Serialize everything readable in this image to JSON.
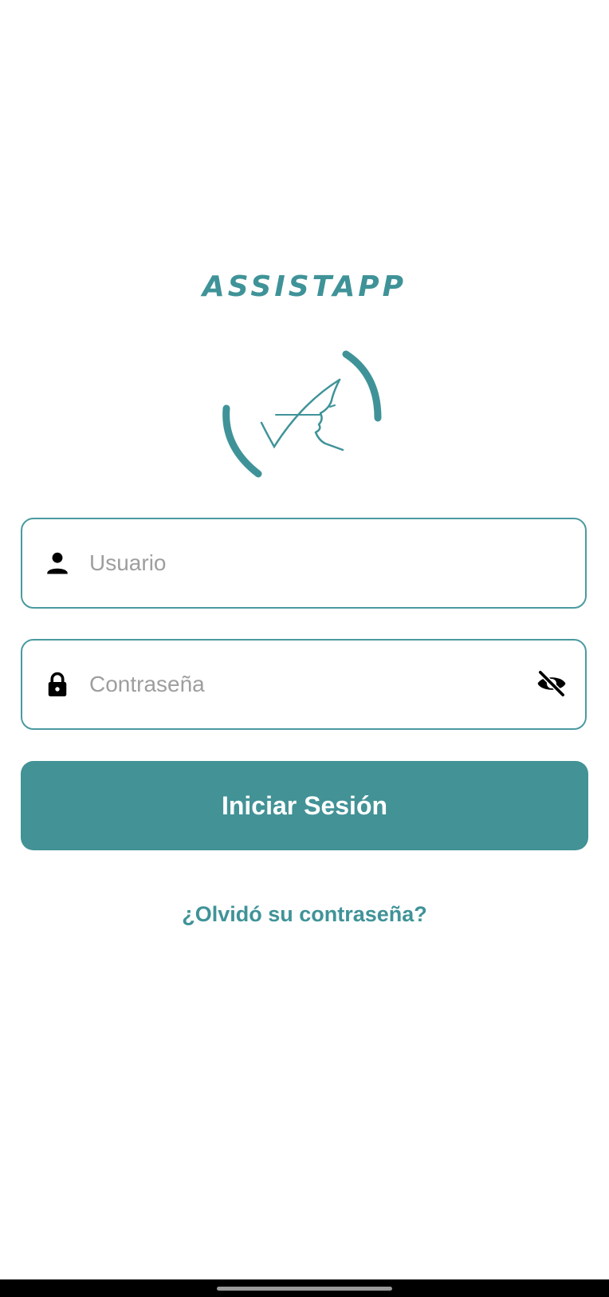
{
  "app": {
    "title": "ASSISTAPP",
    "accent_color": "#429296"
  },
  "logo": {
    "name": "assistapp-logo"
  },
  "login_form": {
    "username": {
      "placeholder": "Usuario",
      "value": "",
      "icon": "person-icon"
    },
    "password": {
      "placeholder": "Contraseña",
      "value": "",
      "icon": "lock-icon",
      "toggle_icon": "eye-off-icon"
    },
    "submit_label": "Iniciar Sesión",
    "forgot_link": "¿Olvidó su contraseña?"
  },
  "system": {
    "nav_bar": "gesture-handle"
  }
}
